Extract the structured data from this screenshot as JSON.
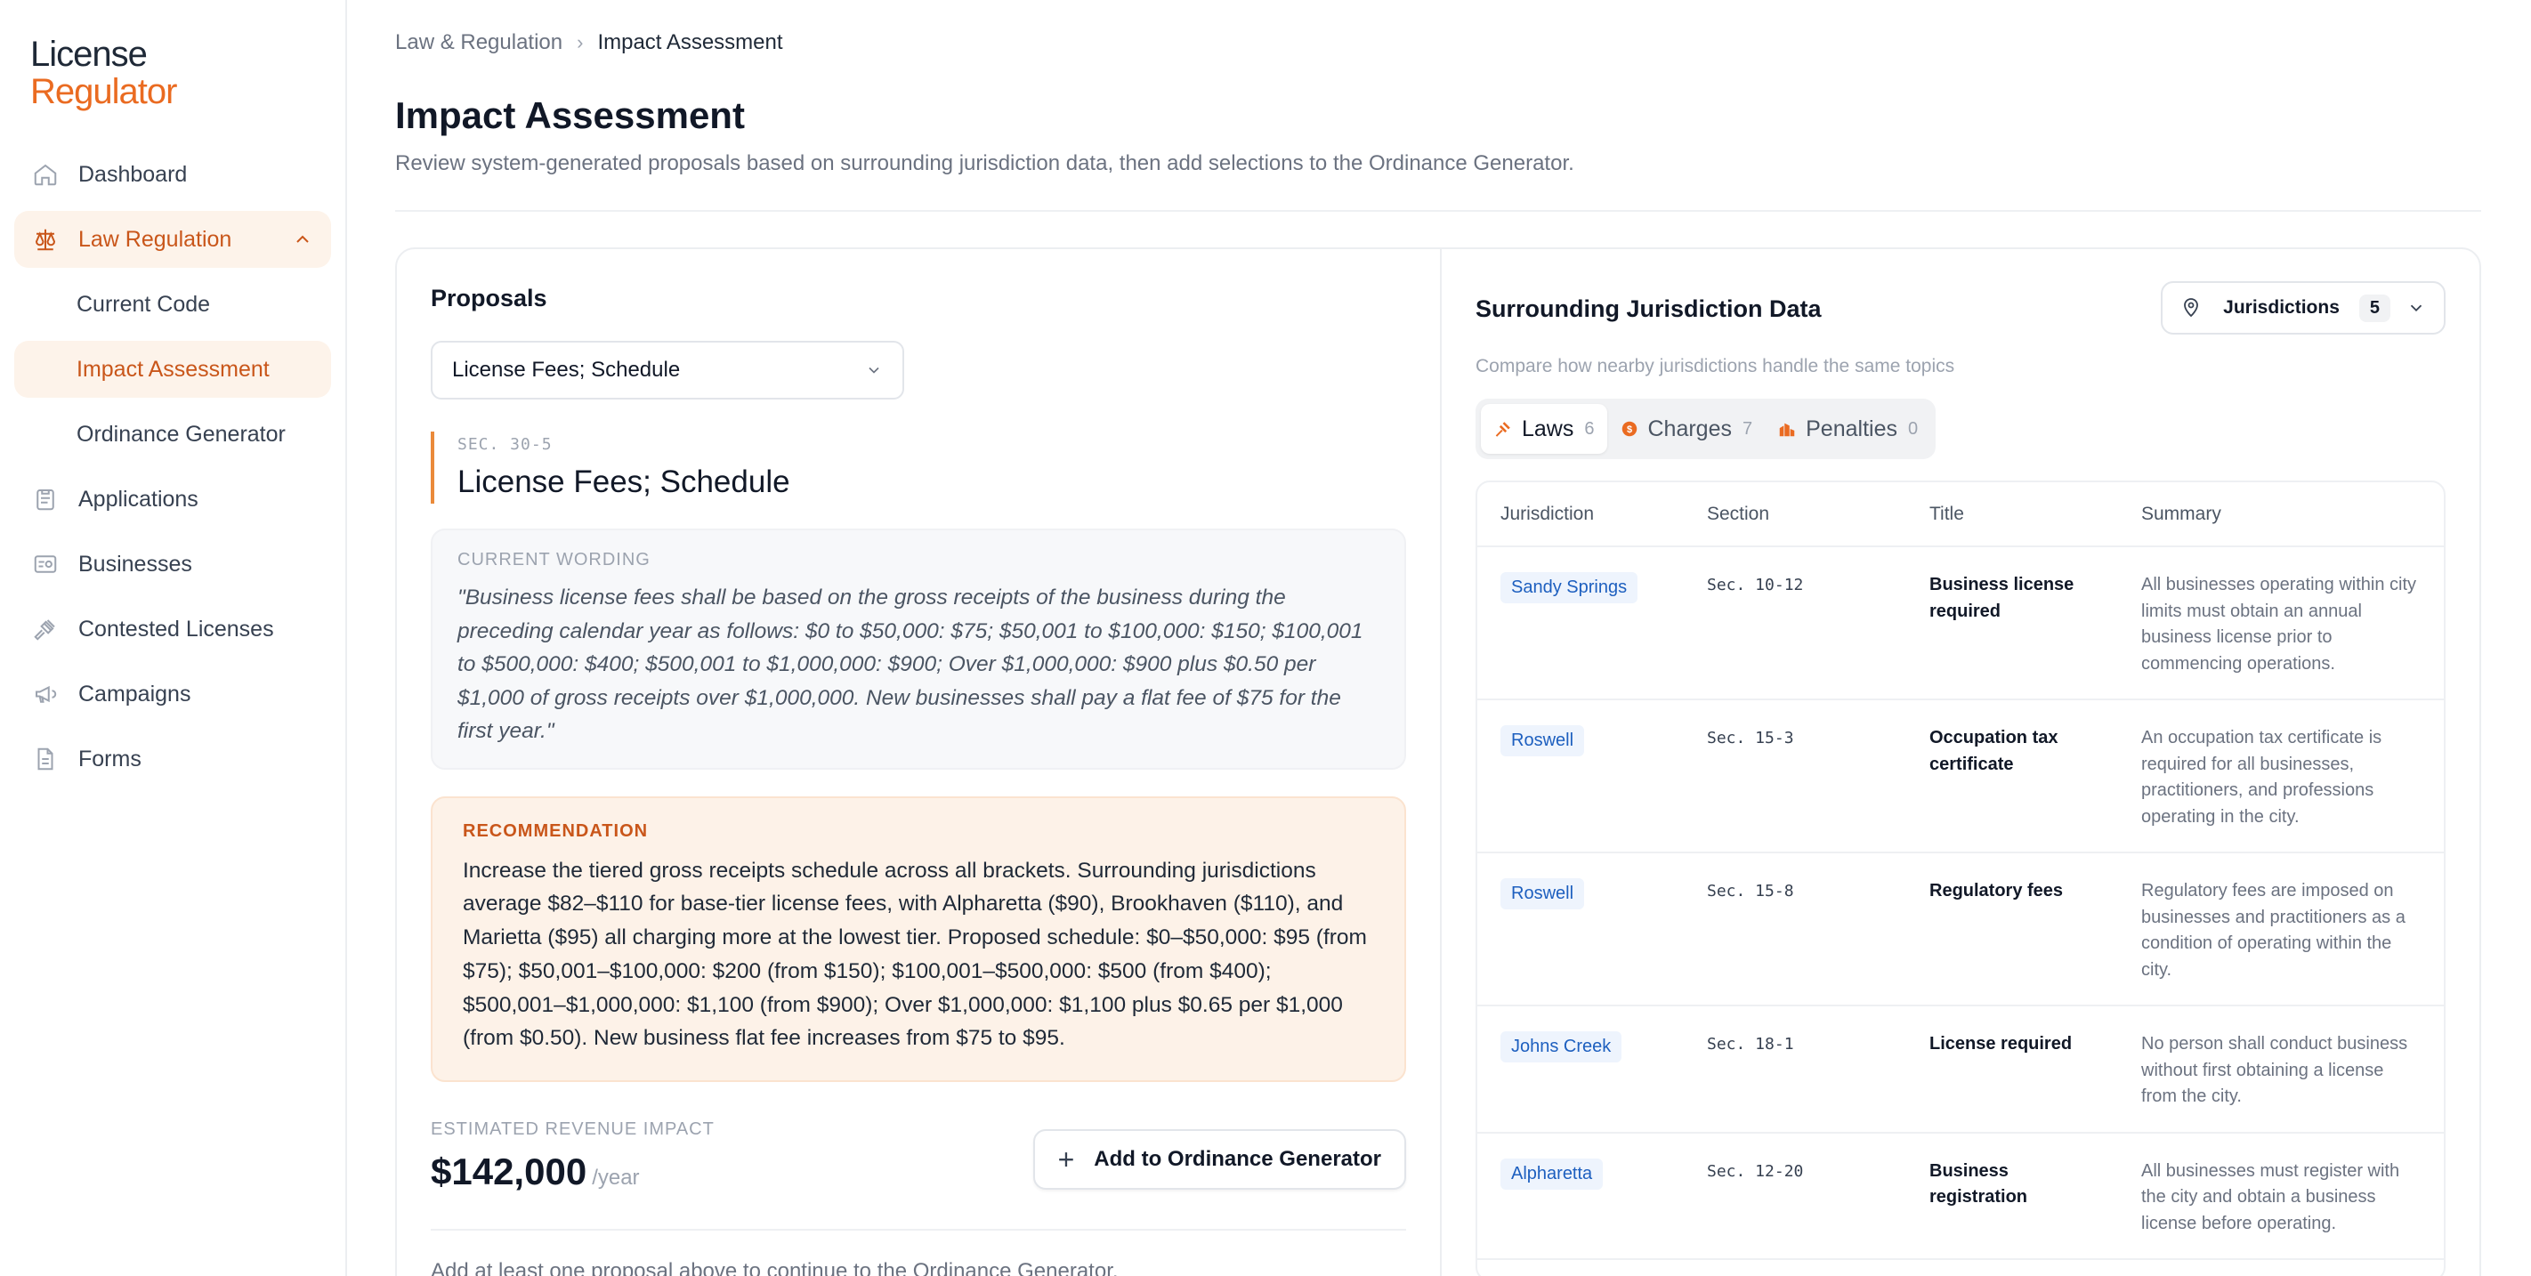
{
  "app": {
    "logo_line1": "License",
    "logo_line2": "Regulator"
  },
  "sidebar": {
    "items": [
      {
        "label": "Dashboard"
      },
      {
        "label": "Law Regulation"
      },
      {
        "label": "Current Code"
      },
      {
        "label": "Impact Assessment"
      },
      {
        "label": "Ordinance Generator"
      },
      {
        "label": "Applications"
      },
      {
        "label": "Businesses"
      },
      {
        "label": "Contested Licenses"
      },
      {
        "label": "Campaigns"
      },
      {
        "label": "Forms"
      }
    ]
  },
  "breadcrumb": {
    "parent": "Law & Regulation",
    "current": "Impact Assessment"
  },
  "header": {
    "title": "Impact Assessment",
    "subtitle": "Review system-generated proposals based on surrounding jurisdiction data, then add selections to the Ordinance Generator."
  },
  "proposals": {
    "heading": "Proposals",
    "selected": "License Fees; Schedule",
    "section_number": "SEC. 30-5",
    "section_title": "License Fees; Schedule",
    "current_label": "CURRENT WORDING",
    "current_text": "\"Business license fees shall be based on the gross receipts of the business during the preceding calendar year as follows: $0 to $50,000: $75; $50,001 to $100,000: $150; $100,001 to $500,000: $400; $500,001 to $1,000,000: $900; Over $1,000,000: $900 plus $0.50 per $1,000 of gross receipts over $1,000,000. New businesses shall pay a flat fee of $75 for the first year.\"",
    "recommendation_label": "RECOMMENDATION",
    "recommendation_text": "Increase the tiered gross receipts schedule across all brackets. Surrounding jurisdictions average $82–$110 for base-tier license fees, with Alpharetta ($90), Brookhaven ($110), and Marietta ($95) all charging more at the lowest tier. Proposed schedule: $0–$50,000: $95 (from $75); $50,001–$100,000: $200 (from $150); $100,001–$500,000: $500 (from $400); $500,001–$1,000,000: $1,100 (from $900); Over $1,000,000: $1,100 plus $0.65 per $1,000 (from $0.50). New business flat fee increases from $75 to $95.",
    "impact_label": "ESTIMATED REVENUE IMPACT",
    "impact_value": "$142,000",
    "impact_unit": "/year",
    "add_button": "Add to Ordinance Generator",
    "hint": "Add at least one proposal above to continue to the Ordinance Generator."
  },
  "jurisdiction": {
    "title": "Surrounding Jurisdiction Data",
    "subtitle": "Compare how nearby jurisdictions handle the same topics",
    "filter_label": "Jurisdictions",
    "filter_count": "5",
    "tabs": [
      {
        "label": "Laws",
        "count": "6"
      },
      {
        "label": "Charges",
        "count": "7"
      },
      {
        "label": "Penalties",
        "count": "0"
      }
    ],
    "columns": [
      "Jurisdiction",
      "Section",
      "Title",
      "Summary"
    ],
    "rows": [
      {
        "jurisdiction": "Sandy Springs",
        "section": "Sec. 10-12",
        "title": "Business license required",
        "summary": "All businesses operating within city limits must obtain an annual business license prior to commencing operations."
      },
      {
        "jurisdiction": "Roswell",
        "section": "Sec. 15-3",
        "title": "Occupation tax certificate",
        "summary": "An occupation tax certificate is required for all businesses, practitioners, and professions operating in the city."
      },
      {
        "jurisdiction": "Roswell",
        "section": "Sec. 15-8",
        "title": "Regulatory fees",
        "summary": "Regulatory fees are imposed on businesses and practitioners as a condition of operating within the city."
      },
      {
        "jurisdiction": "Johns Creek",
        "section": "Sec. 18-1",
        "title": "License required",
        "summary": "No person shall conduct business without first obtaining a license from the city."
      },
      {
        "jurisdiction": "Alpharetta",
        "section": "Sec. 12-20",
        "title": "Business registration",
        "summary": "All businesses must register with the city and obtain a business license before operating."
      }
    ]
  }
}
